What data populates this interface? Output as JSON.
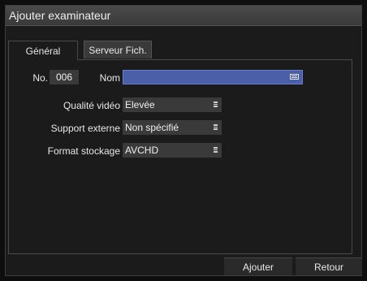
{
  "window": {
    "title": "Ajouter examinateur"
  },
  "tabs": [
    {
      "label": "Général",
      "active": true
    },
    {
      "label": "Serveur Fich.",
      "active": false
    }
  ],
  "form": {
    "no_label": "No.",
    "no_value": "006",
    "name_label": "Nom",
    "name_value": "",
    "name_icon": "keyboard-icon",
    "quality_label": "Qualité vidéo",
    "quality_value": "Elevée",
    "support_label": "Support externe",
    "support_value": "Non spécifié",
    "format_label": "Format stockage",
    "format_value": "AVCHD",
    "select_icon": "menu-icon"
  },
  "buttons": {
    "add_label": "Ajouter",
    "back_label": "Retour"
  },
  "colors": {
    "name_field_bg": "#4a5fa8",
    "field_bg": "#3a3a3a",
    "dialog_bg": "#1b1b1b"
  }
}
